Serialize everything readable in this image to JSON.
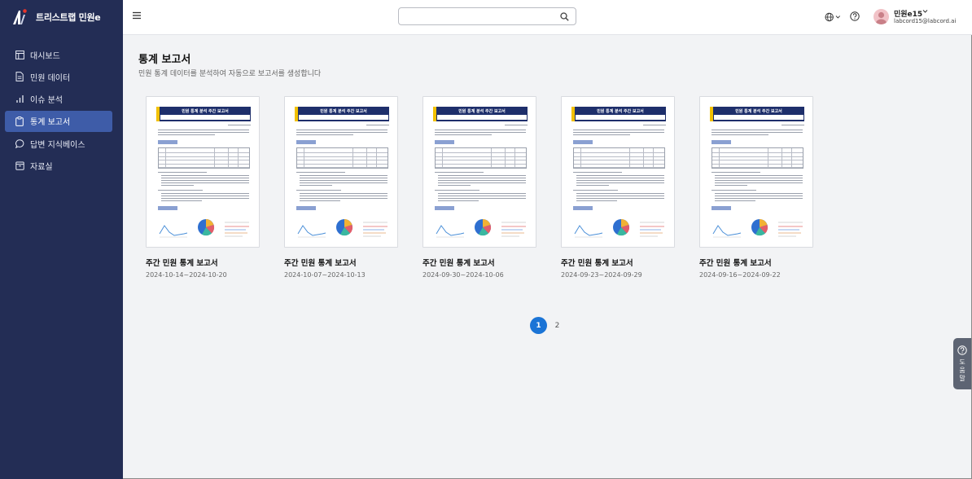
{
  "app": {
    "brand_name": "트리스트랩 민원e"
  },
  "sidebar": {
    "items": [
      {
        "label": "대시보드",
        "icon": "layout-icon",
        "active": false
      },
      {
        "label": "민원 데이터",
        "icon": "document-icon",
        "active": false
      },
      {
        "label": "이슈 분석",
        "icon": "bar-chart-icon",
        "active": false
      },
      {
        "label": "통계 보고서",
        "icon": "clipboard-icon",
        "active": true
      },
      {
        "label": "답변 지식베이스",
        "icon": "chat-bubble-icon",
        "active": false
      },
      {
        "label": "자료실",
        "icon": "archive-icon",
        "active": false
      }
    ]
  },
  "header": {
    "search": {
      "value": "",
      "placeholder": ""
    },
    "user": {
      "name": "민원e15",
      "email": "labcord15@labcord.ai"
    }
  },
  "main": {
    "title": "통계 보고서",
    "subtitle": "민원 통계 데이터를 분석하여 자동으로 보고서를 생성합니다",
    "reports": [
      {
        "title": "주간 민원 통계 보고서",
        "date_range": "2024-10-14~2024-10-20"
      },
      {
        "title": "주간 민원 통계 보고서",
        "date_range": "2024-10-07~2024-10-13"
      },
      {
        "title": "주간 민원 통계 보고서",
        "date_range": "2024-09-30~2024-10-06"
      },
      {
        "title": "주간 민원 통계 보고서",
        "date_range": "2024-09-23~2024-09-29"
      },
      {
        "title": "주간 민원 통계 보고서",
        "date_range": "2024-09-16~2024-09-22"
      }
    ],
    "thumbnail": {
      "header_title": "민원 통계 분석 주간 보고서"
    },
    "pagination": {
      "pages": [
        "1",
        "2"
      ],
      "current": "1"
    }
  },
  "help_tab": {
    "label": "도움말"
  },
  "colors": {
    "sidebar_bg": "#232d55",
    "sidebar_active": "#3e5ca8",
    "accent": "#1b74d6",
    "doc_header": "#1e2f6b"
  }
}
